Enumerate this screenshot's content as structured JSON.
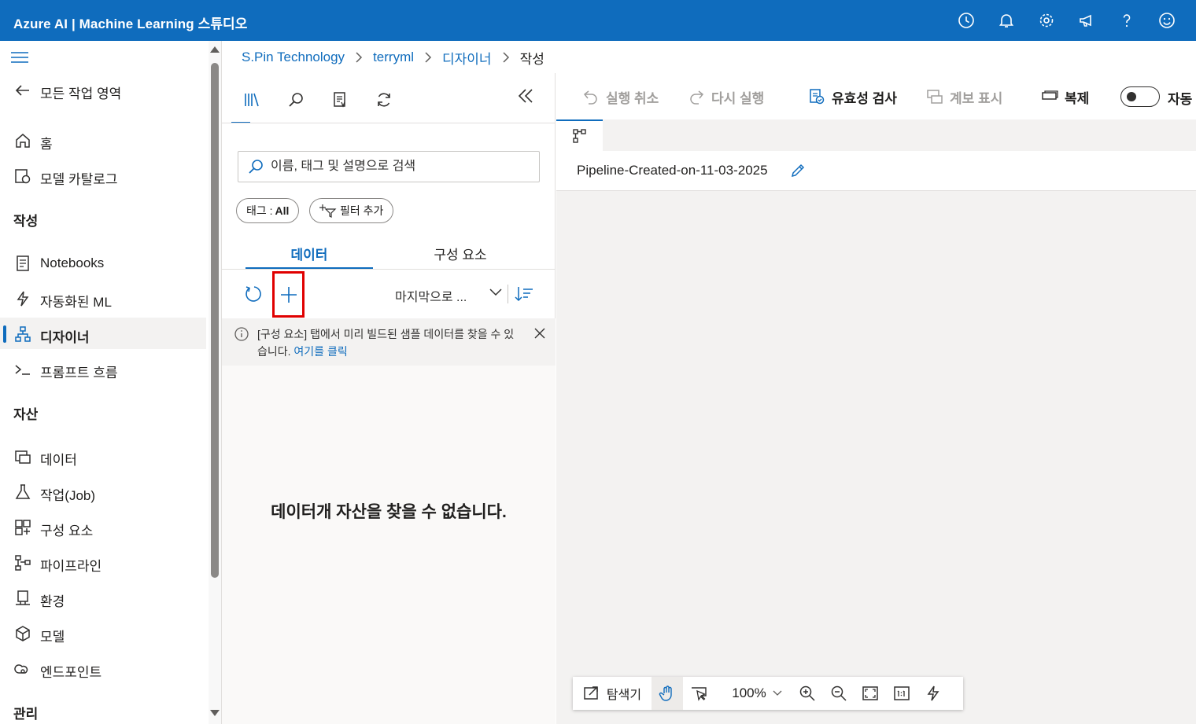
{
  "app": {
    "title": "Azure AI | Machine Learning 스튜디오",
    "top_icons": [
      "history-icon",
      "bell-icon",
      "gear-icon",
      "megaphone-icon",
      "help-icon",
      "smiley-icon"
    ]
  },
  "nav": {
    "back_label": "모든 작업 영역",
    "items_top": [
      {
        "label": "홈",
        "icon": "home-icon"
      },
      {
        "label": "모델 카탈로그",
        "icon": "catalog-icon"
      }
    ],
    "section_author": "작성",
    "items_author": [
      {
        "label": "Notebooks",
        "icon": "notebook-icon"
      },
      {
        "label": "자동화된 ML",
        "icon": "automl-icon"
      },
      {
        "label": "디자이너",
        "icon": "designer-icon",
        "active": true
      },
      {
        "label": "프롬프트 흐름",
        "icon": "prompt-flow-icon"
      }
    ],
    "section_assets": "자산",
    "items_assets": [
      {
        "label": "데이터",
        "icon": "data-icon"
      },
      {
        "label": "작업(Job)",
        "icon": "job-icon"
      },
      {
        "label": "구성 요소",
        "icon": "components-icon"
      },
      {
        "label": "파이프라인",
        "icon": "pipeline-icon"
      },
      {
        "label": "환경",
        "icon": "environment-icon"
      },
      {
        "label": "모델",
        "icon": "model-icon"
      },
      {
        "label": "엔드포인트",
        "icon": "endpoint-icon"
      }
    ],
    "section_manage": "관리"
  },
  "breadcrumb": [
    "S.Pin Technology",
    "terryml",
    "디자이너",
    "작성"
  ],
  "asset_panel": {
    "search_placeholder": "이름, 태그 및 설명으로 검색",
    "tag_chip_label": "태그 : ",
    "tag_chip_value": "All",
    "add_filter_label": "필터 추가",
    "tabs": [
      "데이터",
      "구성 요소"
    ],
    "active_tab": 0,
    "sort_label": "마지막으로 ...",
    "info_message": "[구성 요소] 탭에서 미리 빌드된 샘플 데이터를 찾을 수 있습니다.",
    "info_link": "여기를 클릭",
    "empty_message": "데이터개 자산을 찾을 수 없습니다."
  },
  "toolbar": {
    "undo": "실행 취소",
    "redo": "다시 실행",
    "validate": "유효성 검사",
    "show_lineage": "계보 표시",
    "clone": "복제",
    "auto_label": "자동"
  },
  "pipeline": {
    "name": "Pipeline-Created-on-11-03-2025"
  },
  "zoom": {
    "explorer_label": "탐색기",
    "zoom_level": "100%"
  },
  "colors": {
    "brand": "#0f6cbd",
    "highlight": "#e00000"
  }
}
